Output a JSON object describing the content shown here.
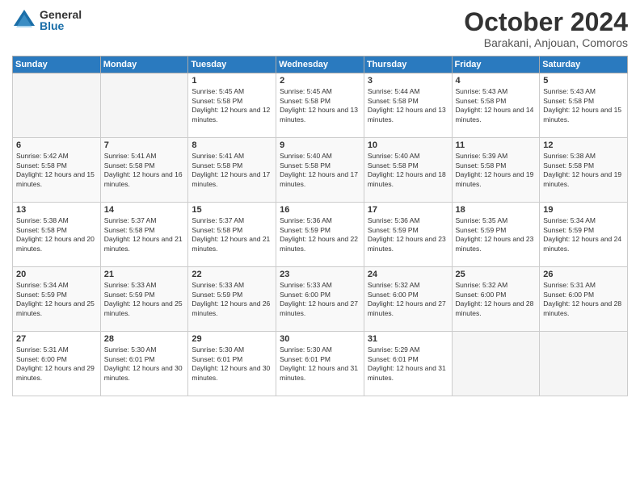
{
  "logo": {
    "general": "General",
    "blue": "Blue"
  },
  "header": {
    "month": "October 2024",
    "location": "Barakani, Anjouan, Comoros"
  },
  "weekdays": [
    "Sunday",
    "Monday",
    "Tuesday",
    "Wednesday",
    "Thursday",
    "Friday",
    "Saturday"
  ],
  "weeks": [
    [
      {
        "day": "",
        "sunrise": "",
        "sunset": "",
        "daylight": ""
      },
      {
        "day": "",
        "sunrise": "",
        "sunset": "",
        "daylight": ""
      },
      {
        "day": "1",
        "sunrise": "Sunrise: 5:45 AM",
        "sunset": "Sunset: 5:58 PM",
        "daylight": "Daylight: 12 hours and 12 minutes."
      },
      {
        "day": "2",
        "sunrise": "Sunrise: 5:45 AM",
        "sunset": "Sunset: 5:58 PM",
        "daylight": "Daylight: 12 hours and 13 minutes."
      },
      {
        "day": "3",
        "sunrise": "Sunrise: 5:44 AM",
        "sunset": "Sunset: 5:58 PM",
        "daylight": "Daylight: 12 hours and 13 minutes."
      },
      {
        "day": "4",
        "sunrise": "Sunrise: 5:43 AM",
        "sunset": "Sunset: 5:58 PM",
        "daylight": "Daylight: 12 hours and 14 minutes."
      },
      {
        "day": "5",
        "sunrise": "Sunrise: 5:43 AM",
        "sunset": "Sunset: 5:58 PM",
        "daylight": "Daylight: 12 hours and 15 minutes."
      }
    ],
    [
      {
        "day": "6",
        "sunrise": "Sunrise: 5:42 AM",
        "sunset": "Sunset: 5:58 PM",
        "daylight": "Daylight: 12 hours and 15 minutes."
      },
      {
        "day": "7",
        "sunrise": "Sunrise: 5:41 AM",
        "sunset": "Sunset: 5:58 PM",
        "daylight": "Daylight: 12 hours and 16 minutes."
      },
      {
        "day": "8",
        "sunrise": "Sunrise: 5:41 AM",
        "sunset": "Sunset: 5:58 PM",
        "daylight": "Daylight: 12 hours and 17 minutes."
      },
      {
        "day": "9",
        "sunrise": "Sunrise: 5:40 AM",
        "sunset": "Sunset: 5:58 PM",
        "daylight": "Daylight: 12 hours and 17 minutes."
      },
      {
        "day": "10",
        "sunrise": "Sunrise: 5:40 AM",
        "sunset": "Sunset: 5:58 PM",
        "daylight": "Daylight: 12 hours and 18 minutes."
      },
      {
        "day": "11",
        "sunrise": "Sunrise: 5:39 AM",
        "sunset": "Sunset: 5:58 PM",
        "daylight": "Daylight: 12 hours and 19 minutes."
      },
      {
        "day": "12",
        "sunrise": "Sunrise: 5:38 AM",
        "sunset": "Sunset: 5:58 PM",
        "daylight": "Daylight: 12 hours and 19 minutes."
      }
    ],
    [
      {
        "day": "13",
        "sunrise": "Sunrise: 5:38 AM",
        "sunset": "Sunset: 5:58 PM",
        "daylight": "Daylight: 12 hours and 20 minutes."
      },
      {
        "day": "14",
        "sunrise": "Sunrise: 5:37 AM",
        "sunset": "Sunset: 5:58 PM",
        "daylight": "Daylight: 12 hours and 21 minutes."
      },
      {
        "day": "15",
        "sunrise": "Sunrise: 5:37 AM",
        "sunset": "Sunset: 5:58 PM",
        "daylight": "Daylight: 12 hours and 21 minutes."
      },
      {
        "day": "16",
        "sunrise": "Sunrise: 5:36 AM",
        "sunset": "Sunset: 5:59 PM",
        "daylight": "Daylight: 12 hours and 22 minutes."
      },
      {
        "day": "17",
        "sunrise": "Sunrise: 5:36 AM",
        "sunset": "Sunset: 5:59 PM",
        "daylight": "Daylight: 12 hours and 23 minutes."
      },
      {
        "day": "18",
        "sunrise": "Sunrise: 5:35 AM",
        "sunset": "Sunset: 5:59 PM",
        "daylight": "Daylight: 12 hours and 23 minutes."
      },
      {
        "day": "19",
        "sunrise": "Sunrise: 5:34 AM",
        "sunset": "Sunset: 5:59 PM",
        "daylight": "Daylight: 12 hours and 24 minutes."
      }
    ],
    [
      {
        "day": "20",
        "sunrise": "Sunrise: 5:34 AM",
        "sunset": "Sunset: 5:59 PM",
        "daylight": "Daylight: 12 hours and 25 minutes."
      },
      {
        "day": "21",
        "sunrise": "Sunrise: 5:33 AM",
        "sunset": "Sunset: 5:59 PM",
        "daylight": "Daylight: 12 hours and 25 minutes."
      },
      {
        "day": "22",
        "sunrise": "Sunrise: 5:33 AM",
        "sunset": "Sunset: 5:59 PM",
        "daylight": "Daylight: 12 hours and 26 minutes."
      },
      {
        "day": "23",
        "sunrise": "Sunrise: 5:33 AM",
        "sunset": "Sunset: 6:00 PM",
        "daylight": "Daylight: 12 hours and 27 minutes."
      },
      {
        "day": "24",
        "sunrise": "Sunrise: 5:32 AM",
        "sunset": "Sunset: 6:00 PM",
        "daylight": "Daylight: 12 hours and 27 minutes."
      },
      {
        "day": "25",
        "sunrise": "Sunrise: 5:32 AM",
        "sunset": "Sunset: 6:00 PM",
        "daylight": "Daylight: 12 hours and 28 minutes."
      },
      {
        "day": "26",
        "sunrise": "Sunrise: 5:31 AM",
        "sunset": "Sunset: 6:00 PM",
        "daylight": "Daylight: 12 hours and 28 minutes."
      }
    ],
    [
      {
        "day": "27",
        "sunrise": "Sunrise: 5:31 AM",
        "sunset": "Sunset: 6:00 PM",
        "daylight": "Daylight: 12 hours and 29 minutes."
      },
      {
        "day": "28",
        "sunrise": "Sunrise: 5:30 AM",
        "sunset": "Sunset: 6:01 PM",
        "daylight": "Daylight: 12 hours and 30 minutes."
      },
      {
        "day": "29",
        "sunrise": "Sunrise: 5:30 AM",
        "sunset": "Sunset: 6:01 PM",
        "daylight": "Daylight: 12 hours and 30 minutes."
      },
      {
        "day": "30",
        "sunrise": "Sunrise: 5:30 AM",
        "sunset": "Sunset: 6:01 PM",
        "daylight": "Daylight: 12 hours and 31 minutes."
      },
      {
        "day": "31",
        "sunrise": "Sunrise: 5:29 AM",
        "sunset": "Sunset: 6:01 PM",
        "daylight": "Daylight: 12 hours and 31 minutes."
      },
      {
        "day": "",
        "sunrise": "",
        "sunset": "",
        "daylight": ""
      },
      {
        "day": "",
        "sunrise": "",
        "sunset": "",
        "daylight": ""
      }
    ]
  ]
}
